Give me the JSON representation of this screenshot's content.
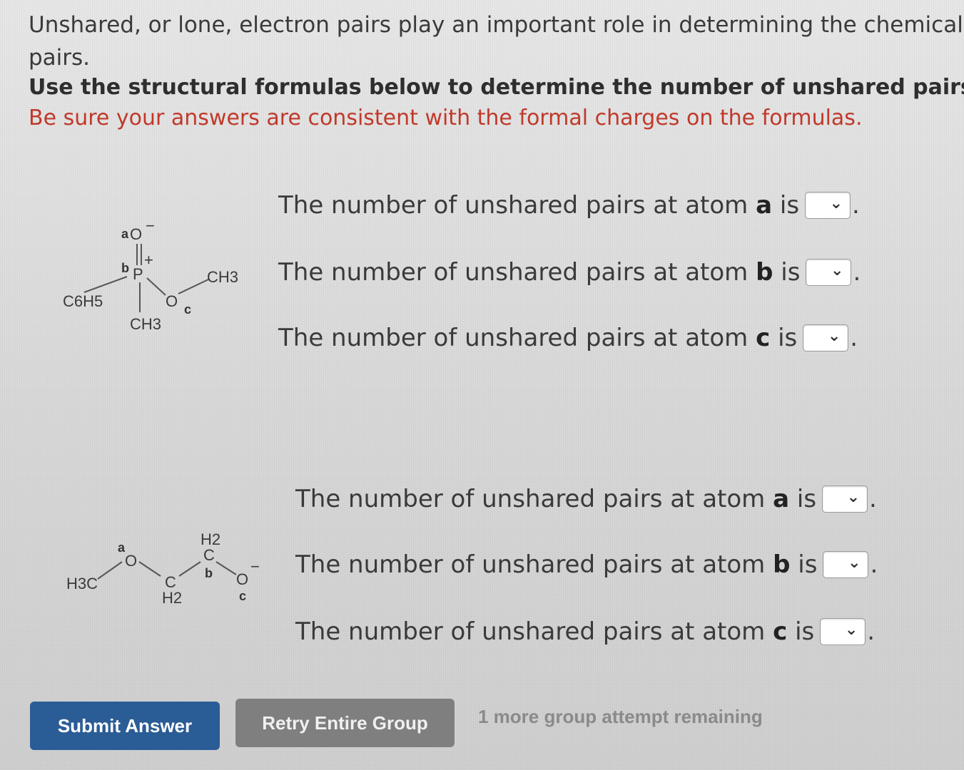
{
  "intro_text": "Unshared, or lone, electron pairs play an important role in determining the chemical and",
  "intro_text_2": "pairs.",
  "instruction": "Use the structural formulas below to determine the number of unshared pairs at e",
  "note": "Be sure your answers are consistent with the formal charges on the formulas.",
  "question_prefix": "The number of unshared pairs at atom",
  "question_suffix": "is",
  "structure_1": {
    "atoms": {
      "o_top": "O",
      "charge_minus": "−",
      "p": "P",
      "charge_plus": "+",
      "c6h5": "C6H5",
      "o_mid": "O",
      "ch3_right": "CH3",
      "ch3_bottom": "CH3"
    },
    "labels": {
      "a": "a",
      "b": "b",
      "c": "c"
    }
  },
  "structure_2": {
    "atoms": {
      "h3c": "H3C",
      "o_left": "O",
      "c_low": "C",
      "h2_low": "H2",
      "h2_top": "H2",
      "c_top": "C",
      "o_right": "O",
      "charge_minus": "−"
    },
    "labels": {
      "a": "a",
      "b": "b",
      "c": "c"
    }
  },
  "questions_1": [
    {
      "atom": "a",
      "selected": ""
    },
    {
      "atom": "b",
      "selected": ""
    },
    {
      "atom": "c",
      "selected": ""
    }
  ],
  "questions_2": [
    {
      "atom": "a",
      "selected": ""
    },
    {
      "atom": "b",
      "selected": ""
    },
    {
      "atom": "c",
      "selected": ""
    }
  ],
  "buttons": {
    "submit": "Submit Answer",
    "retry": "Retry Entire Group"
  },
  "attempts_text": "1 more group attempt remaining",
  "colors": {
    "submit": "#2a5c96",
    "retry": "#7f7f7f",
    "note": "#c0392b"
  }
}
